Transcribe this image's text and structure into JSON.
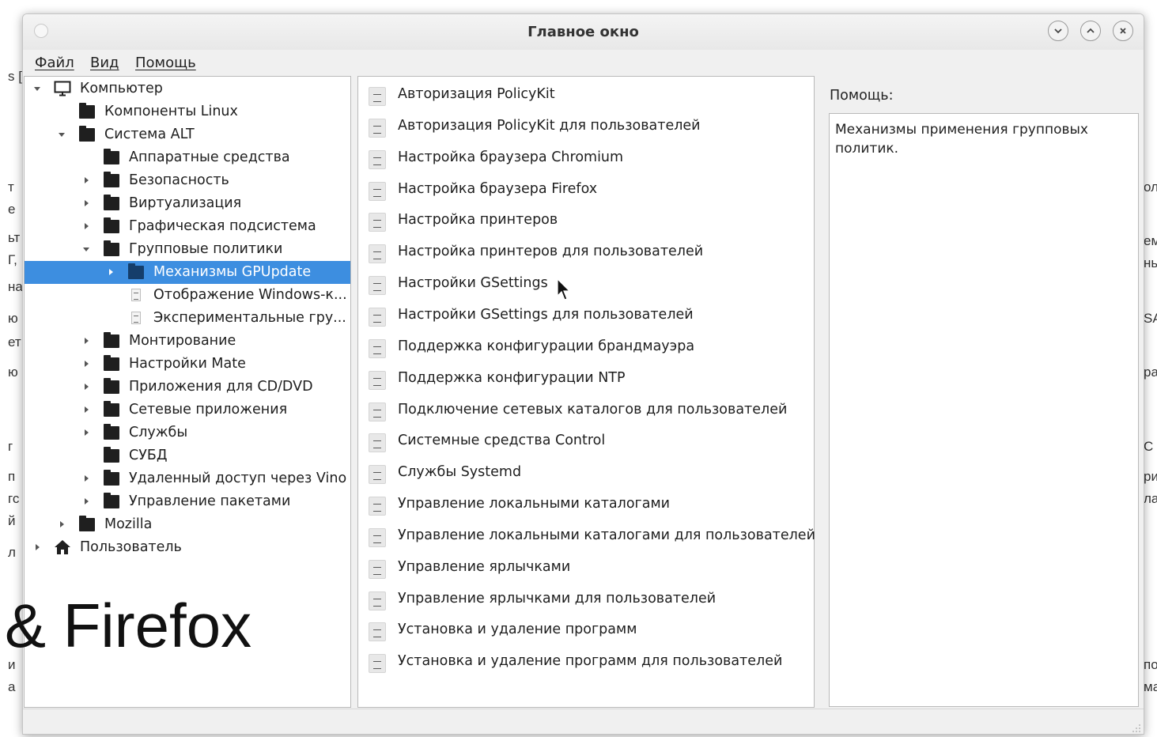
{
  "window": {
    "title": "Главное окно",
    "controls": {
      "minimize": "minimize",
      "maximize": "maximize",
      "close": "close"
    }
  },
  "menubar": {
    "items": [
      {
        "label": "Файл"
      },
      {
        "label": "Вид"
      },
      {
        "label": "Помощь"
      }
    ]
  },
  "tree": {
    "items": [
      {
        "label": "Компьютер",
        "icon": "computer-icon",
        "expanded": true
      },
      {
        "label": "Компоненты Linux",
        "icon": "folder-icon"
      },
      {
        "label": "Система ALT",
        "icon": "folder-icon",
        "expanded": true
      },
      {
        "label": "Аппаратные средства",
        "icon": "folder-icon"
      },
      {
        "label": "Безопасность",
        "icon": "folder-icon",
        "expanded": false
      },
      {
        "label": "Виртуализация",
        "icon": "folder-icon",
        "expanded": false
      },
      {
        "label": "Графическая подсистема",
        "icon": "folder-icon",
        "expanded": false
      },
      {
        "label": "Групповые политики",
        "icon": "folder-icon",
        "expanded": true
      },
      {
        "label": "Механизмы GPUpdate",
        "icon": "folder-icon",
        "expanded": false,
        "selected": true
      },
      {
        "label": "Отображение Windows-к...",
        "icon": "document-icon"
      },
      {
        "label": "Экспериментальные гру...",
        "icon": "document-icon"
      },
      {
        "label": "Монтирование",
        "icon": "folder-icon",
        "expanded": false
      },
      {
        "label": "Настройки Mate",
        "icon": "folder-icon",
        "expanded": false
      },
      {
        "label": "Приложения для CD/DVD",
        "icon": "folder-icon",
        "expanded": false
      },
      {
        "label": "Сетевые приложения",
        "icon": "folder-icon",
        "expanded": false
      },
      {
        "label": "Службы",
        "icon": "folder-icon",
        "expanded": false
      },
      {
        "label": "СУБД",
        "icon": "folder-icon"
      },
      {
        "label": "Удаленный доступ через Vino",
        "icon": "folder-icon",
        "expanded": false
      },
      {
        "label": "Управление пакетами",
        "icon": "folder-icon",
        "expanded": false
      },
      {
        "label": "Mozilla",
        "icon": "folder-icon",
        "expanded": false
      },
      {
        "label": "Пользователь",
        "icon": "home-icon",
        "expanded": false
      }
    ]
  },
  "list": {
    "items": [
      {
        "label": "Авторизация PolicyKit"
      },
      {
        "label": "Авторизация PolicyKit для пользователей"
      },
      {
        "label": "Настройка браузера Chromium"
      },
      {
        "label": "Настройка браузера Firefox"
      },
      {
        "label": "Настройка принтеров"
      },
      {
        "label": "Настройка принтеров для пользователей"
      },
      {
        "label": "Настройки GSettings"
      },
      {
        "label": "Настройки GSettings для пользователей"
      },
      {
        "label": "Поддержка конфигурации брандмауэра"
      },
      {
        "label": "Поддержка конфигурации NTP"
      },
      {
        "label": "Подключение сетевых каталогов для пользователей"
      },
      {
        "label": "Системные средства Control"
      },
      {
        "label": "Службы Systemd"
      },
      {
        "label": "Управление локальными каталогами"
      },
      {
        "label": "Управление локальными каталогами для пользователей"
      },
      {
        "label": "Управление ярлычками"
      },
      {
        "label": "Управление ярлычками для пользователей"
      },
      {
        "label": "Установка и удаление программ"
      },
      {
        "label": "Установка и удаление программ для пользователей"
      }
    ]
  },
  "help": {
    "label": "Помощь:",
    "text": "Механизмы применения групповых политик."
  },
  "background": {
    "big_text": "& Firefox",
    "left_fragments": [
      "s [",
      "т",
      "е",
      "ьт",
      "Г,",
      "на",
      "ю",
      "ет",
      "ю",
      "г",
      "п",
      "гс",
      "й",
      "л",
      "и",
      "а"
    ],
    "right_fragments": [
      "ол",
      "ем",
      "нь",
      "SA",
      "ра",
      "С",
      "ри",
      "ла",
      "по",
      "ма"
    ]
  },
  "colors": {
    "selection": "#3d8ee0",
    "window_bg": "#f0f0f0",
    "panel_border": "#b9b9b9"
  }
}
